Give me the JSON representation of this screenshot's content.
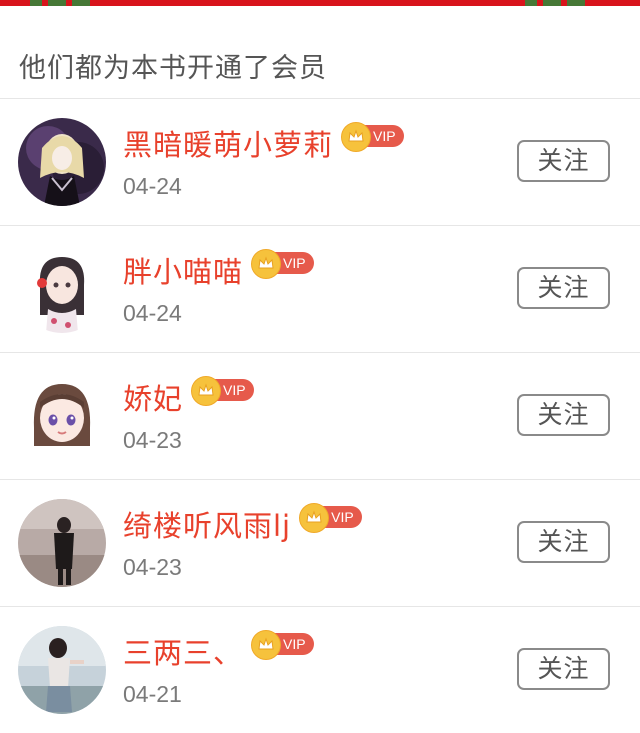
{
  "section": {
    "title": "他们都为本书开通了会员"
  },
  "vip_badge_label": "VIP",
  "follow_label": "关注",
  "members": [
    {
      "name": "黑暗暖萌小萝莉",
      "date": "04-24"
    },
    {
      "name": "胖小喵喵",
      "date": "04-24"
    },
    {
      "name": "娇妃",
      "date": "04-23"
    },
    {
      "name": "绮楼听风雨lj",
      "date": "04-23"
    },
    {
      "name": "三两三、",
      "date": "04-21"
    }
  ],
  "colors": {
    "banner": "#d8141c",
    "name": "#e8412c",
    "vip_badge": "#e65a4b",
    "vip_crown": "#f6c23c"
  }
}
